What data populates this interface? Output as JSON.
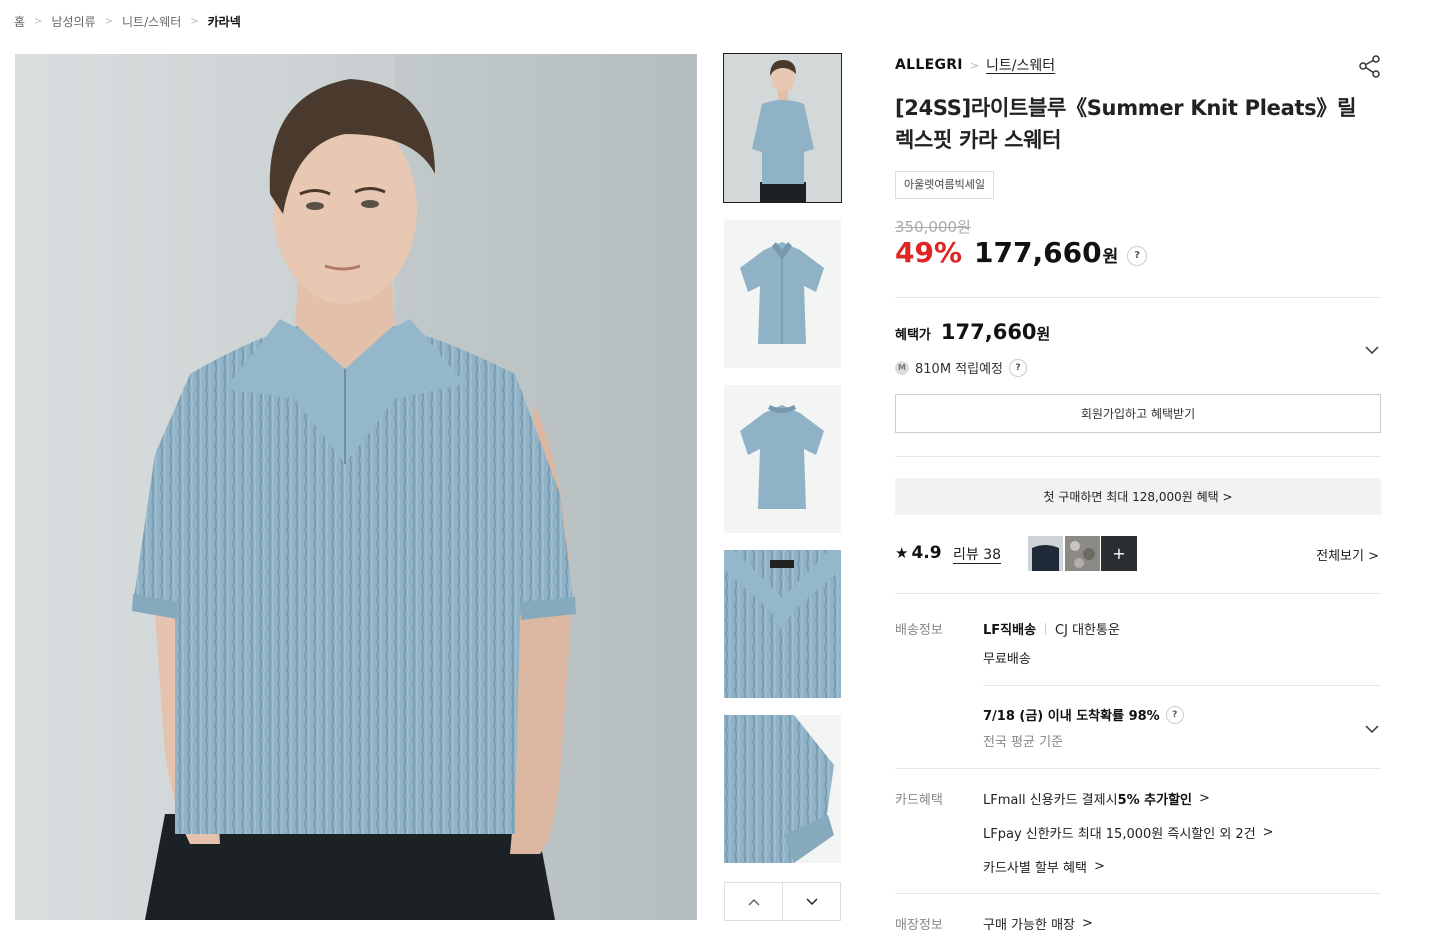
{
  "breadcrumb": [
    "홈",
    "남성의류",
    "니트/스웨터",
    "카라넥"
  ],
  "product": {
    "brand": "ALLEGRI",
    "category": "니트/스웨터",
    "title": "[24SS]라이트블루《Summer Knit Pleats》릴렉스핏 카라 스웨터",
    "tag": "아울렛여름빅세일",
    "original_price": "350,000원",
    "discount": "49%",
    "price": "177,660",
    "won": "원",
    "help": "?"
  },
  "benefit": {
    "label": "혜택가",
    "price": "177,660",
    "won": "원",
    "points_badge": "M",
    "points": "810M 적립예정",
    "join_button": "회원가입하고 혜택받기",
    "first_purchase": "첫 구매하면 최대 128,000원 혜택 >"
  },
  "review": {
    "star": "★",
    "rating": "4.9",
    "link": "리뷰 38",
    "more": "+",
    "see_all": "전체보기 >"
  },
  "shipping": {
    "label": "배송정보",
    "method": "LF직배송",
    "carrier": "CJ 대한통운",
    "fee": "무료배송",
    "arrival": "7/18 (금) 이내 도착확률 98%",
    "basis": "전국 평균 기준"
  },
  "card": {
    "label": "카드혜택",
    "line1_prefix": "LFmall 신용카드 결제시 ",
    "line1_bold": "5% 추가할인",
    "line2": "LFpay 신한카드 최대 15,000원 즉시할인 외 2건",
    "line3": "카드사별 할부 혜택"
  },
  "store": {
    "label": "매장정보",
    "link": "구매 가능한 매장"
  },
  "icons": {
    "share": "share-icon",
    "chevron": "chevron-down-icon",
    "nav_up": "chevron-up-icon",
    "nav_down": "chevron-down-icon"
  },
  "colors": {
    "discount": "#e02424",
    "shirt": "#8fb2c6",
    "pants": "#1c2126"
  }
}
